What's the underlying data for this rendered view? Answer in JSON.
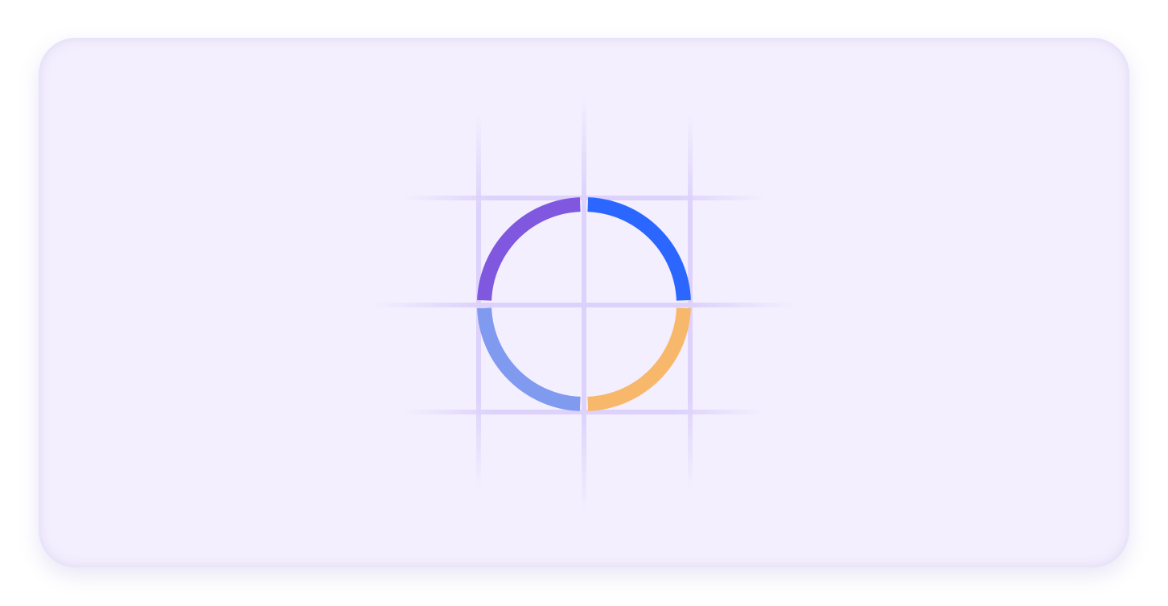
{
  "illustration": {
    "icon": "segmented-ring-icon",
    "background_color": "#f4effe",
    "grid_color": "#ddd2fb",
    "segments": [
      {
        "quadrant": "top-right",
        "color": "#2b67ff"
      },
      {
        "quadrant": "bottom-right",
        "color": "#f8b86c"
      },
      {
        "quadrant": "bottom-left",
        "color": "#7f9aef"
      },
      {
        "quadrant": "top-left",
        "color": "#8058df"
      }
    ]
  }
}
